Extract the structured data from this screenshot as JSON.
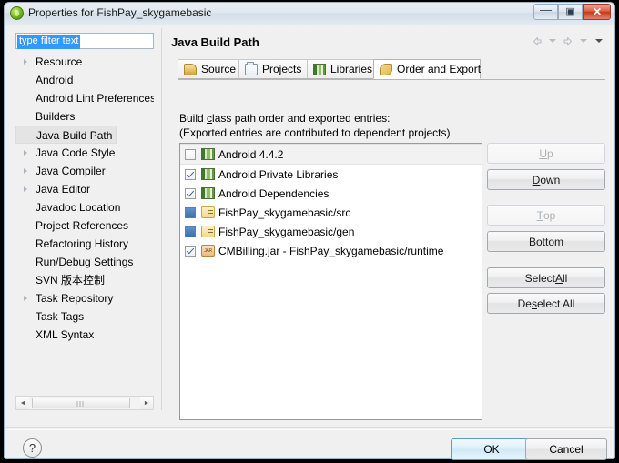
{
  "window": {
    "title": "Properties for FishPay_skygamebasic",
    "icon": "eclipse-green-icon",
    "controls": {
      "minimize": "—",
      "maximize": "▣",
      "close": "✕"
    }
  },
  "filter": {
    "value": "type filter text",
    "placeholder": "type filter text"
  },
  "tree": {
    "items": [
      {
        "label": "Resource",
        "expandable": true,
        "selected": false
      },
      {
        "label": "Android",
        "expandable": false,
        "selected": false
      },
      {
        "label": "Android Lint Preferences",
        "expandable": false,
        "selected": false
      },
      {
        "label": "Builders",
        "expandable": false,
        "selected": false
      },
      {
        "label": "Java Build Path",
        "expandable": false,
        "selected": true
      },
      {
        "label": "Java Code Style",
        "expandable": true,
        "selected": false
      },
      {
        "label": "Java Compiler",
        "expandable": true,
        "selected": false
      },
      {
        "label": "Java Editor",
        "expandable": true,
        "selected": false
      },
      {
        "label": "Javadoc Location",
        "expandable": false,
        "selected": false
      },
      {
        "label": "Project References",
        "expandable": false,
        "selected": false
      },
      {
        "label": "Refactoring History",
        "expandable": false,
        "selected": false
      },
      {
        "label": "Run/Debug Settings",
        "expandable": false,
        "selected": false
      },
      {
        "label": "SVN 版本控制",
        "expandable": false,
        "selected": false
      },
      {
        "label": "Task Repository",
        "expandable": true,
        "selected": false
      },
      {
        "label": "Task Tags",
        "expandable": false,
        "selected": false
      },
      {
        "label": "XML Syntax",
        "expandable": false,
        "selected": false
      }
    ],
    "scrollbar": {
      "left_arrow": "◄",
      "right_arrow": "►"
    }
  },
  "content": {
    "title": "Java Build Path",
    "nav": {
      "back_icon": "back-arrow-icon",
      "back_menu_icon": "chevron-down-icon",
      "forward_icon": "forward-arrow-icon",
      "forward_menu_icon": "chevron-down-icon",
      "view_menu_icon": "chevron-down-icon"
    },
    "tabs": [
      {
        "label": "Source",
        "icon": "source-folder-icon",
        "active": false
      },
      {
        "label": "Projects",
        "icon": "project-icon",
        "active": false
      },
      {
        "label": "Libraries",
        "icon": "library-icon",
        "active": false
      },
      {
        "label": "Order and Export",
        "icon": "order-export-icon",
        "active": true
      }
    ],
    "instructions": {
      "line1_before": "Build ",
      "line1_mnemonic": "c",
      "line1_after": "lass path order and exported entries:",
      "line2": "(Exported entries are contributed to dependent projects)"
    },
    "entries": [
      {
        "label": "Android 4.4.2",
        "state": "unchecked",
        "icon": "android-library-icon",
        "selected": true
      },
      {
        "label": "Android Private Libraries",
        "state": "checked",
        "icon": "android-library-icon",
        "selected": false
      },
      {
        "label": "Android Dependencies",
        "state": "checked",
        "icon": "android-library-icon",
        "selected": false
      },
      {
        "label": "FishPay_skygamebasic/src",
        "state": "blueblock",
        "icon": "source-folder-icon",
        "selected": false
      },
      {
        "label": "FishPay_skygamebasic/gen",
        "state": "blueblock",
        "icon": "source-folder-icon",
        "selected": false
      },
      {
        "label": "CMBilling.jar - FishPay_skygamebasic/runtime",
        "state": "checked",
        "icon": "jar-icon",
        "selected": false
      }
    ],
    "side_buttons": [
      {
        "label": "Up",
        "mnemonic": "U",
        "enabled": false
      },
      {
        "label": "Down",
        "mnemonic": "D",
        "enabled": true
      },
      {
        "label": "Top",
        "mnemonic": "T",
        "enabled": false
      },
      {
        "label": "Bottom",
        "mnemonic": "B",
        "enabled": true
      },
      {
        "label": "Select All",
        "mnemonic": "A",
        "enabled": true
      },
      {
        "label": "Deselect All",
        "mnemonic": "s",
        "enabled": true
      }
    ]
  },
  "footer": {
    "help_icon": "?",
    "ok_label": "OK",
    "cancel_label": "Cancel"
  },
  "colors": {
    "accent": "#3399ff",
    "ok_border": "#5a9ec8",
    "close_button": "#c43a1c",
    "selection": "#e4e4e4"
  }
}
